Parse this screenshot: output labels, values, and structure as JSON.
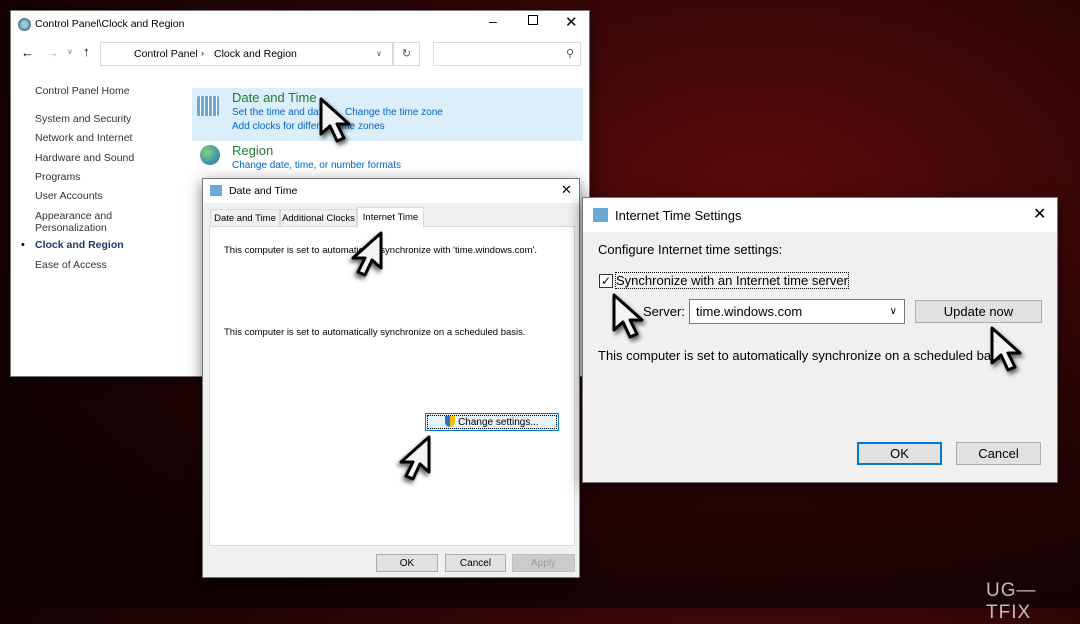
{
  "control_panel": {
    "title": "Control Panel\\Clock and Region",
    "breadcrumb": [
      "Control Panel",
      "Clock and Region"
    ],
    "sidebar": [
      "Control Panel Home",
      "System and Security",
      "Network and Internet",
      "Hardware and Sound",
      "Programs",
      "User Accounts",
      "Appearance and",
      "Personalization",
      "Clock and Region",
      "Ease of Access"
    ],
    "date_time": {
      "title": "Date and Time",
      "link1": "Set the time and date",
      "link2": "Change the time zone",
      "link3": "Add clocks for different time zones"
    },
    "region": {
      "title": "Region",
      "link1": "Change date, time, or number formats"
    }
  },
  "date_time_dialog": {
    "title": "Date and Time",
    "tabs": [
      "Date and Time",
      "Additional Clocks",
      "Internet Time"
    ],
    "text1": "This computer is set to automatically synchronize with 'time.windows.com'.",
    "text2": "This computer is set to automatically synchronize on a scheduled basis.",
    "change_settings": "Change settings...",
    "ok": "OK",
    "cancel": "Cancel",
    "apply": "Apply"
  },
  "internet_time_settings": {
    "title": "Internet Time Settings",
    "configure": "Configure Internet time settings:",
    "sync_label": "Synchronize with an Internet time server",
    "sync_checked": true,
    "server_label": "Server:",
    "server_value": "time.windows.com",
    "update_now": "Update now",
    "status": "This computer is set to automatically synchronize on a scheduled basis.",
    "ok": "OK",
    "cancel": "Cancel"
  },
  "watermark": "UG—TFIX"
}
